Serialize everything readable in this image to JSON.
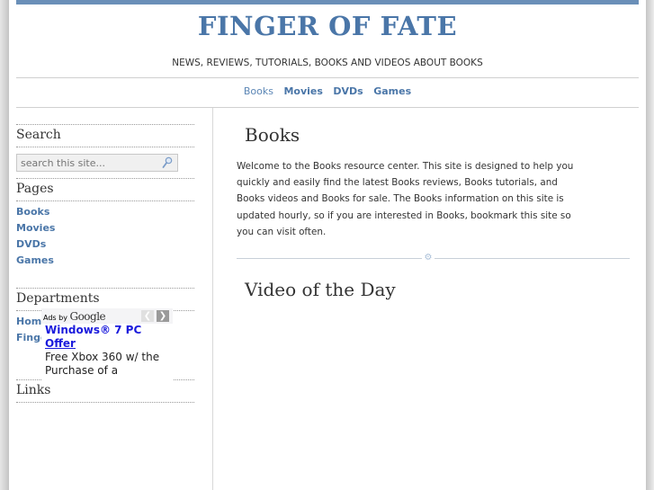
{
  "header": {
    "title": "FINGER OF FATE",
    "tagline": "NEWS, REVIEWS, TUTORIALS, BOOKS AND VIDEOS ABOUT BOOKS"
  },
  "nav": {
    "items": [
      {
        "label": "Books",
        "current": true
      },
      {
        "label": "Movies",
        "current": false
      },
      {
        "label": "DVDs",
        "current": false
      },
      {
        "label": "Games",
        "current": false
      }
    ]
  },
  "sidebar": {
    "search": {
      "heading": "Search",
      "placeholder": "search this site...",
      "icon": "search-icon"
    },
    "pages": {
      "heading": "Pages",
      "items": [
        "Books",
        "Movies",
        "DVDs",
        "Games"
      ]
    },
    "departments": {
      "heading": "Departments",
      "items": [
        "Home",
        "Finger Of Fate"
      ]
    },
    "links": {
      "heading": "Links"
    },
    "ad": {
      "ads_by": "Ads by",
      "brand": "Google",
      "prev_icon": "chevron-left-icon",
      "next_icon": "chevron-right-icon",
      "title_line1": "Windows® 7 PC",
      "title_line2": "Offer",
      "text_line1": "Free Xbox 360 w/ the",
      "text_line2": "Purchase of a"
    }
  },
  "main": {
    "heading": "Books",
    "intro": "Welcome to the Books resource center. This site is designed to help you quickly and easily find the latest Books reviews, Books tutorials, and Books videos and Books for sale. The Books information on this site is updated hourly, so if you are interested in Books, bookmark this site so you can visit often.",
    "divider_icon": "gear-ornament-icon",
    "video_heading": "Video of the Day"
  },
  "colors": {
    "accent": "#4a76a8",
    "topbar": "#6a8fb8",
    "ad_link": "#1a1adc"
  }
}
